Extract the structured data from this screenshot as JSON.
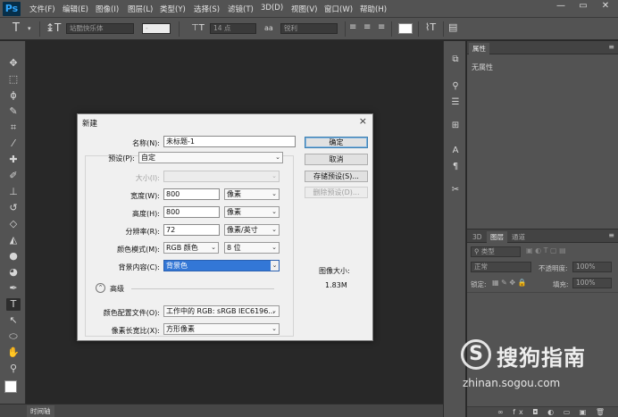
{
  "app": {
    "logo": "Ps",
    "menu": [
      "文件(F)",
      "编辑(E)",
      "图像(I)",
      "图层(L)",
      "类型(Y)",
      "选择(S)",
      "滤镜(T)",
      "3D(D)",
      "视图(V)",
      "窗口(W)",
      "帮助(H)"
    ]
  },
  "window_controls": {
    "minimize": "—",
    "maximize": "▭",
    "close": "✕"
  },
  "options": {
    "tool_icon": "T",
    "font_family": "站酷快乐体",
    "font_style": "-",
    "font_size": "14 点",
    "aa_label": "aa",
    "aa_mode": "锐利",
    "orient_icon": "↕T"
  },
  "dialog": {
    "title": "新建",
    "close": "×",
    "name_label": "名称(N):",
    "name_value": "未标题-1",
    "preset_label": "预设(P):",
    "preset_value": "自定",
    "size_label": "大小(I):",
    "width_label": "宽度(W):",
    "width_value": "800",
    "width_unit": "像素",
    "height_label": "高度(H):",
    "height_value": "800",
    "height_unit": "像素",
    "resolution_label": "分辨率(R):",
    "resolution_value": "72",
    "resolution_unit": "像素/英寸",
    "color_mode_label": "颜色模式(M):",
    "color_mode_value": "RGB 颜色",
    "bit_depth": "8 位",
    "bg_label": "背景内容(C):",
    "bg_value": "背景色",
    "advanced": "高级",
    "profile_label": "颜色配置文件(O):",
    "profile_value": "工作中的 RGB: sRGB IEC6196...",
    "aspect_label": "像素长宽比(X):",
    "aspect_value": "方形像素",
    "ok": "确定",
    "cancel": "取消",
    "save_preset": "存储预设(S)...",
    "delete_preset": "删除预设(D)...",
    "image_size_label": "图像大小:",
    "image_size_value": "1.83M"
  },
  "properties": {
    "tab": "属性",
    "empty": "无属性"
  },
  "layers": {
    "tabs": [
      "3D",
      "图层",
      "通道"
    ],
    "filter": "类型",
    "blend_mode": "正常",
    "opacity_label": "不透明度:",
    "opacity_value": "100%",
    "lock_label": "锁定:",
    "fill_label": "填充:",
    "fill_value": "100%",
    "footer_icons": "∞ fx ◘ ◐ ▭ ▣ 🗑"
  },
  "timeline": {
    "tab": "时间轴"
  },
  "watermark": {
    "brand": "搜狗指南",
    "url": "zhinan.sogou.com"
  }
}
